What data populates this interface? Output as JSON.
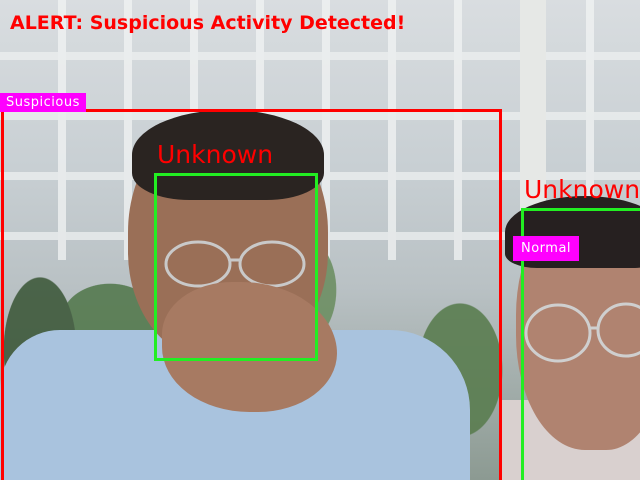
{
  "alert": {
    "text": "ALERT: Suspicious Activity Detected!",
    "color": "#ff0000"
  },
  "detections": {
    "person_box": {
      "label": "Suspicious",
      "box_color": "#ff0000",
      "label_bg": "#ff00ff"
    },
    "faces": [
      {
        "label": "Unknown",
        "box_color": "#22ee22",
        "label_color": "#ff0000"
      },
      {
        "label": "Unknown",
        "box_color": "#22ee22",
        "label_color": "#ff0000",
        "status": "Normal",
        "status_bg": "#ff00ff"
      }
    ]
  },
  "icons": [
    "glasses-icon"
  ]
}
